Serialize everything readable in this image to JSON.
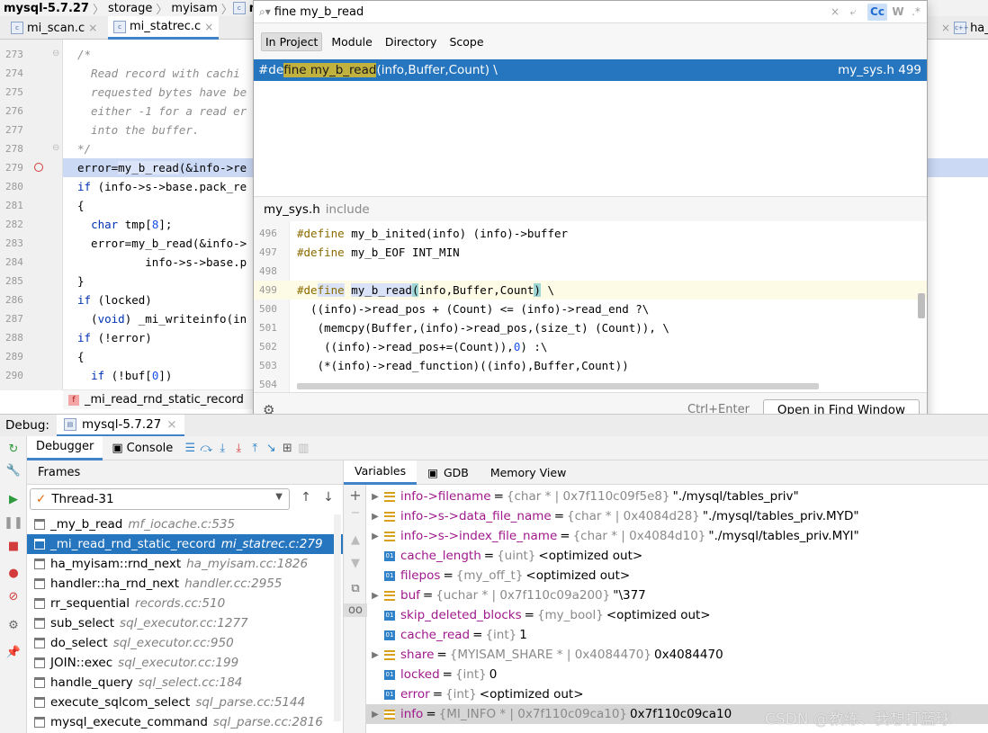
{
  "breadcrumb": [
    "mysql-5.7.27",
    "storage",
    "myisam",
    "mi_s"
  ],
  "tabs": [
    {
      "icon": "c",
      "label": "mi_scan.c"
    },
    {
      "icon": "c",
      "label": "mi_statrec.c"
    },
    {
      "icon": "c",
      "label": "ha_"
    }
  ],
  "editor": {
    "lines": [
      {
        "num": "273",
        "html": "<span class=\"c-com\">/*</span>"
      },
      {
        "num": "274",
        "html": "<span class=\"c-com\">  Read record with cachi</span>"
      },
      {
        "num": "275",
        "html": "<span class=\"c-com\">  requested bytes have be</span>"
      },
      {
        "num": "276",
        "html": "<span class=\"c-com\">  either -1 for a read er</span>"
      },
      {
        "num": "277",
        "html": "<span class=\"c-com\">  into the buffer.</span>"
      },
      {
        "num": "278",
        "html": "<span class=\"c-com\">*/</span>"
      },
      {
        "num": "279",
        "html": "error=<span class=\"hlid\">my_b_read</span>(&amp;info-&gt;re"
      },
      {
        "num": "280",
        "html": "<span class=\"c-kw\">if</span> (info-&gt;s-&gt;base.pack_re"
      },
      {
        "num": "281",
        "html": "{"
      },
      {
        "num": "282",
        "html": "  <span class=\"c-kw\">char</span> tmp[<span class=\"c-num\">8</span>];"
      },
      {
        "num": "283",
        "html": "  error=my_b_read(&amp;info-&gt;"
      },
      {
        "num": "284",
        "html": "          info-&gt;s-&gt;base.p"
      },
      {
        "num": "285",
        "html": "}"
      },
      {
        "num": "286",
        "html": "<span class=\"c-kw\">if</span> (locked)"
      },
      {
        "num": "287",
        "html": "  (<span class=\"c-kw\">void</span>) _mi_writeinfo(in"
      },
      {
        "num": "288",
        "html": "<span class=\"c-kw\">if</span> (!error)"
      },
      {
        "num": "289",
        "html": "{"
      },
      {
        "num": "290",
        "html": "  <span class=\"c-kw\">if</span> (!buf[<span class=\"c-num\">0</span>])"
      }
    ],
    "function_crumb": "_mi_read_rnd_static_record"
  },
  "find": {
    "query": "fine my_b_read",
    "options": [
      "×",
      "⤶",
      "Cc",
      "W",
      ".*"
    ],
    "scopes": [
      "In Project",
      "Module",
      "Directory",
      "Scope"
    ],
    "result": {
      "prefix": "#de",
      "match": "fine my_b_read",
      "suffix": "(info,Buffer,Count) \\",
      "file": "my_sys.h 499"
    },
    "preview_file": "my_sys.h",
    "preview_dir": "include",
    "preview_lines": [
      {
        "num": "496",
        "html": "<span class=\"pre-kw\">#define</span> my_b_inited(info) (info)-&gt;buffer"
      },
      {
        "num": "497",
        "html": "<span class=\"pre-kw\">#define</span> my_b_EOF INT_MIN"
      },
      {
        "num": "498",
        "html": ""
      },
      {
        "num": "499",
        "html": "<span class=\"pre-kw\">#de</span><span class=\"pm pre-kw\">fine</span> <span class=\"pm\">my_b_read</span><span class=\"paren\">(</span>info,Buffer,Count<span class=\"paren\">)</span> \\"
      },
      {
        "num": "500",
        "html": "  ((info)-&gt;read_pos + (Count) &lt;= (info)-&gt;read_end ?\\"
      },
      {
        "num": "501",
        "html": "   (memcpy(Buffer,(info)-&gt;read_pos,(size_t) (Count)), \\"
      },
      {
        "num": "502",
        "html": "    ((info)-&gt;read_pos+=(Count)),<span class=\"c-num\">0</span>) :\\"
      },
      {
        "num": "503",
        "html": "   (*(info)-&gt;read_function)((info),Buffer,Count))"
      },
      {
        "num": "504",
        "html": ""
      }
    ],
    "shortcut": "Ctrl+Enter",
    "open_button": "Open in Find Window"
  },
  "debug": {
    "title": "Debug:",
    "config": "mysql-5.7.27",
    "tabs": [
      "Debugger",
      "Console"
    ],
    "frames_label": "Frames",
    "thread": "Thread-31",
    "frames": [
      {
        "fn": "_my_b_read",
        "loc": "mf_iocache.c:535"
      },
      {
        "fn": "_mi_read_rnd_static_record",
        "loc": "mi_statrec.c:279"
      },
      {
        "fn": "ha_myisam::rnd_next",
        "loc": "ha_myisam.cc:1826"
      },
      {
        "fn": "handler::ha_rnd_next",
        "loc": "handler.cc:2955"
      },
      {
        "fn": "rr_sequential",
        "loc": "records.cc:510"
      },
      {
        "fn": "sub_select",
        "loc": "sql_executor.cc:1277"
      },
      {
        "fn": "do_select",
        "loc": "sql_executor.cc:950"
      },
      {
        "fn": "JOIN::exec",
        "loc": "sql_executor.cc:199"
      },
      {
        "fn": "handle_query",
        "loc": "sql_select.cc:184"
      },
      {
        "fn": "execute_sqlcom_select",
        "loc": "sql_parse.cc:5144"
      },
      {
        "fn": "mysql_execute_command",
        "loc": "sql_parse.cc:2816"
      }
    ],
    "var_tabs": [
      "Variables",
      "GDB",
      "Memory View"
    ],
    "variables": [
      {
        "exp": true,
        "kind": "struct",
        "name": "info->filename",
        "type": "{char * | 0x7f110c09f5e8}",
        "value": "\"./mysql/tables_priv\""
      },
      {
        "exp": true,
        "kind": "struct",
        "name": "info->s->data_file_name",
        "type": "{char * | 0x4084d28}",
        "value": "\"./mysql/tables_priv.MYD\""
      },
      {
        "exp": true,
        "kind": "struct",
        "name": "info->s->index_file_name",
        "type": "{char * | 0x4084d10}",
        "value": "\"./mysql/tables_priv.MYI\""
      },
      {
        "exp": false,
        "kind": "prim",
        "name": "cache_length",
        "type": "{uint}",
        "value": "<optimized out>"
      },
      {
        "exp": false,
        "kind": "prim",
        "name": "filepos",
        "type": "{my_off_t}",
        "value": "<optimized out>"
      },
      {
        "exp": true,
        "kind": "struct",
        "name": "buf",
        "type": "{uchar * | 0x7f110c09a200}",
        "value": "\"\\377"
      },
      {
        "exp": false,
        "kind": "prim",
        "name": "skip_deleted_blocks",
        "type": "{my_bool}",
        "value": "<optimized out>"
      },
      {
        "exp": false,
        "kind": "prim",
        "name": "cache_read",
        "type": "{int}",
        "value": "1"
      },
      {
        "exp": true,
        "kind": "struct",
        "name": "share",
        "type": "{MYISAM_SHARE * | 0x4084470}",
        "value": "0x4084470"
      },
      {
        "exp": false,
        "kind": "prim",
        "name": "locked",
        "type": "{int}",
        "value": "0"
      },
      {
        "exp": false,
        "kind": "prim",
        "name": "error",
        "type": "{int}",
        "value": "<optimized out>"
      },
      {
        "exp": true,
        "kind": "struct",
        "name": "info",
        "type": "{MI_INFO * | 0x7f110c09ca10}",
        "value": "0x7f110c09ca10"
      }
    ]
  },
  "watermark": "CSDN @教练、我想打篮球"
}
